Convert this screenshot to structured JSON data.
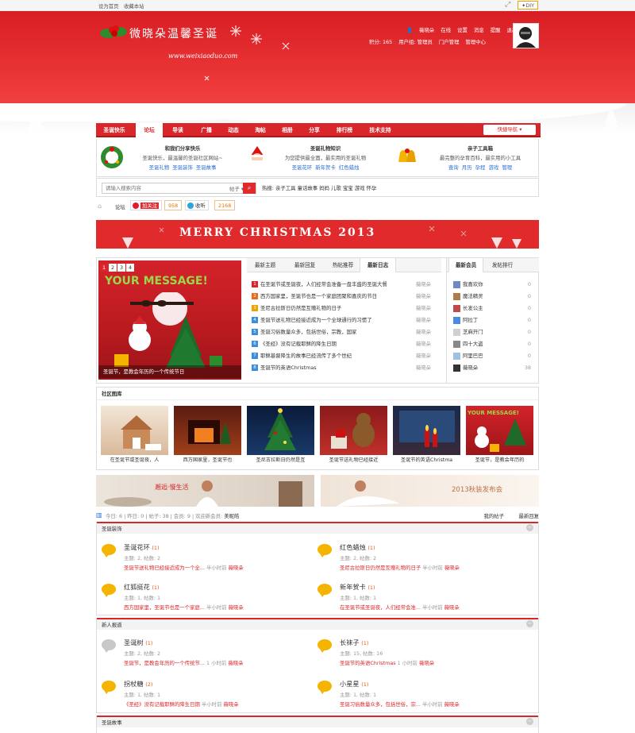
{
  "topbar": {
    "set_home": "设为首页",
    "bookmark": "收藏本站",
    "diy": "DIY"
  },
  "header": {
    "logo_main": "微晓朵温馨圣诞",
    "logo_url": "www.weixiaoduo.com",
    "user": {
      "name": "薇晓朵",
      "status": "在线",
      "settings": "设置",
      "messages": "消息",
      "reminders": "提醒",
      "logout": "退出",
      "points_label": "积分: 165",
      "group_label": "用户组: 管理员",
      "portal_admin": "门户管理",
      "admin_center": "管理中心"
    }
  },
  "nav": {
    "items": [
      "圣诞快乐",
      "论坛",
      "导读",
      "广播",
      "动态",
      "淘帖",
      "相册",
      "分享",
      "排行榜",
      "技术支持"
    ],
    "quick_nav": "快捷导航"
  },
  "categories": [
    {
      "title": "和我们分享快乐",
      "desc": "圣诞快乐，最温馨的圣诞社区网站~",
      "links": [
        "圣诞礼物",
        "圣诞装饰",
        "圣诞故事"
      ]
    },
    {
      "title": "圣诞礼物知识",
      "desc": "为您提供最全面，最实用的圣诞礼物",
      "links": [
        "圣诞花环",
        "新年贺卡",
        "红色蜡烛"
      ]
    },
    {
      "title": "亲子工具箱",
      "desc": "最完整的孕育百科，最实用的小工具",
      "links": [
        "查询",
        "月历",
        "孕程",
        "游戏",
        "管理"
      ]
    }
  ],
  "search": {
    "placeholder": "请输入搜索内容",
    "scope": "帖子",
    "hot_label": "热搜:",
    "hot_terms": [
      "亲子工具",
      "童话故事",
      "妈妈",
      "儿歌",
      "宝宝",
      "游戏",
      "怀孕"
    ]
  },
  "breadcrumb": {
    "home": "论坛",
    "weibo_follow": "加关注",
    "weibo_count": "958",
    "qq_listen": "收听",
    "qq_count": "2168"
  },
  "banner": {
    "text": "MERRY CHRISTMAS 2013"
  },
  "slider": {
    "pages": [
      "1",
      "2",
      "3",
      "4"
    ],
    "caption": "圣诞节，是教会年历的一个传统节日",
    "overlay": "YOUR MESSAGE!"
  },
  "threads": {
    "tabs": [
      "最新主题",
      "最新回复",
      "热帖推荐",
      "最新日志"
    ],
    "items": [
      {
        "n": "1",
        "title": "在圣诞节或圣诞夜，人们经常会准备一盘丰盛的圣诞大餐",
        "author": "薇晓朵"
      },
      {
        "n": "2",
        "title": "西方国家里，圣诞节也是一个家庭团聚和喜庆的节日",
        "author": "薇晓朵"
      },
      {
        "n": "3",
        "title": "圣尼古拉斯日仍然是互赠礼物的日子",
        "author": "薇晓朵"
      },
      {
        "n": "4",
        "title": "圣诞节送礼物已经接近成为一个全球通行的习惯了",
        "author": "薇晓朵"
      },
      {
        "n": "5",
        "title": "圣诞习俗数量众多，包括世俗，宗教，国家",
        "author": "薇晓朵"
      },
      {
        "n": "6",
        "title": "《圣经》没有记载耶稣的降生日期",
        "author": "薇晓朵"
      },
      {
        "n": "7",
        "title": "耶稣基督降生的故事已经流传了多个世纪",
        "author": "薇晓朵"
      },
      {
        "n": "8",
        "title": "圣诞节的英语Christmas",
        "author": "薇晓朵"
      }
    ]
  },
  "members": {
    "tabs": [
      "最新会员",
      "发帖排行"
    ],
    "items": [
      {
        "name": "我喜欢你",
        "count": "0"
      },
      {
        "name": "魔法精灵",
        "count": "0"
      },
      {
        "name": "长发公主",
        "count": "0"
      },
      {
        "name": "阿拉丁",
        "count": "0"
      },
      {
        "name": "芝麻开门",
        "count": "0"
      },
      {
        "name": "四十大盗",
        "count": "0"
      },
      {
        "name": "阿里巴巴",
        "count": "0"
      },
      {
        "name": "薇晓朵",
        "count": "38"
      }
    ]
  },
  "gallery": {
    "title": "社区图库",
    "items": [
      "在圣诞节或圣诞夜，人",
      "西方国家里，圣诞节也",
      "圣尼古拉斯日仍然是互",
      "圣诞节送礼物已经接近",
      "圣诞节的英语Christma",
      "圣诞节，是教会年历的"
    ]
  },
  "ads": {
    "left": "邂逅·慢生活",
    "right": "2013秋装发布会"
  },
  "stats": {
    "today": "今日: 6",
    "yesterday": "昨日: 0",
    "posts": "帖子: 38",
    "members": "会员: 9",
    "welcome": "欢迎新会员:",
    "new_member": "美昵皓",
    "my_posts": "我的帖子",
    "latest_replies": "最新回复"
  },
  "sections": [
    {
      "title": "圣诞装饰",
      "forums": [
        {
          "name": "圣诞花环",
          "count": "(1)",
          "stat": "主题: 2, 帖数: 2",
          "last": "圣诞节送礼物已经接近成为一个全...",
          "time": "半小时前",
          "by": "薇晓朵",
          "color": "#f4b400"
        },
        {
          "name": "红色蜡烛",
          "count": "(1)",
          "stat": "主题: 2, 帖数: 2",
          "last": "圣尼古拉斯日仍然是互赠礼物的日子",
          "time": "半小时前",
          "by": "薇晓朵",
          "color": "#f4b400"
        },
        {
          "name": "红狐挺花",
          "count": "(1)",
          "stat": "主题: 1, 帖数: 1",
          "last": "西方国家里，圣诞节也是一个家庭...",
          "time": "半小时前",
          "by": "薇晓朵",
          "color": "#f4b400"
        },
        {
          "name": "新年贺卡",
          "count": "(1)",
          "stat": "主题: 1, 帖数: 1",
          "last": "在圣诞节或圣诞夜，人们经常会准...",
          "time": "半小时前",
          "by": "薇晓朵",
          "color": "#f4b400"
        }
      ]
    },
    {
      "title": "新人报道",
      "forums": [
        {
          "name": "圣诞树",
          "count": "(1)",
          "stat": "主题: 2, 帖数: 2",
          "last": "圣诞节，是教会年历的一个传统节...",
          "time": "1 小时前",
          "by": "薇晓朵",
          "color": "#c8c8c8"
        },
        {
          "name": "长袜子",
          "count": "(1)",
          "stat": "主题: 15, 帖数: 16",
          "last": "圣诞节的英语Christmas",
          "time": "1 小时前",
          "by": "薇晓朵",
          "color": "#f4b400"
        },
        {
          "name": "拐杖糖",
          "count": "(2)",
          "stat": "主题: 1, 帖数: 1",
          "last": "《圣经》没有记载耶稣的降生日期",
          "time": "半小时前",
          "by": "薇晓朵",
          "color": "#f4b400"
        },
        {
          "name": "小星星",
          "count": "(1)",
          "stat": "主题: 1, 帖数: 1",
          "last": "圣诞习俗数量众多，包括世俗，宗...",
          "time": "半小时前",
          "by": "薇晓朵",
          "color": "#f4b400"
        }
      ]
    },
    {
      "title": "圣诞故事",
      "forums": []
    }
  ]
}
